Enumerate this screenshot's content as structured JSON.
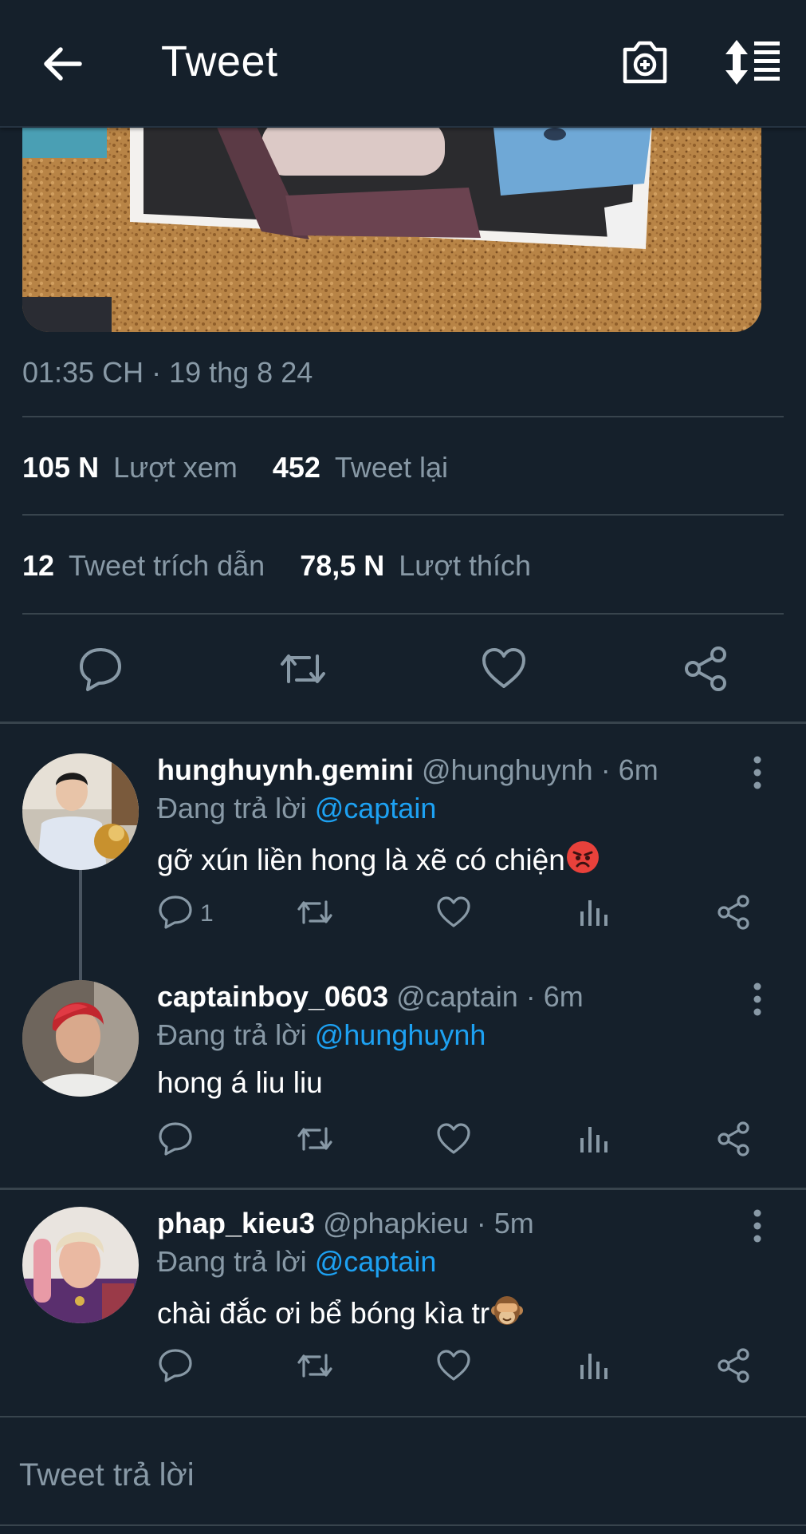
{
  "app": {
    "accent": "#1da1f2",
    "background": "#15202b"
  },
  "topbar": {
    "title": "Tweet",
    "back_icon": "arrow-left-icon",
    "camera_icon": "camera-plus-icon",
    "sort_icon": "sort-list-icon"
  },
  "tweet": {
    "timestamp": "01:35 CH · 19 thg 8 24",
    "stats": {
      "views_count": "105 N",
      "views_label": "Lượt xem",
      "retweets_count": "452",
      "retweets_label": "Tweet lại",
      "quotes_count": "12",
      "quotes_label": "Tweet trích dẫn",
      "likes_count": "78,5 N",
      "likes_label": "Lượt thích"
    }
  },
  "replies": [
    {
      "name": "hunghuynh.gemini",
      "handle": "@hunghuynh · 6m",
      "replying_prefix": "Đang trả lời",
      "replying_to": "@captain",
      "text": "gỡ xún liền hong là xẽ có chiện",
      "emoji": "angry-face-emoji",
      "reply_count": "1"
    },
    {
      "name": "captainboy_0603",
      "handle": "@captain · 6m",
      "replying_prefix": "Đang trả lời",
      "replying_to": "@hunghuynh",
      "text": "hong á liu liu",
      "emoji": "",
      "reply_count": ""
    },
    {
      "name": "phap_kieu3",
      "handle": "@phapkieu · 5m",
      "replying_prefix": "Đang trả lời",
      "replying_to": "@captain",
      "text": "chài đắc ơi bể bóng kìa tr",
      "emoji": "see-no-evil-monkey-emoji",
      "reply_count": ""
    }
  ],
  "compose": {
    "placeholder": "Tweet trả lời"
  }
}
